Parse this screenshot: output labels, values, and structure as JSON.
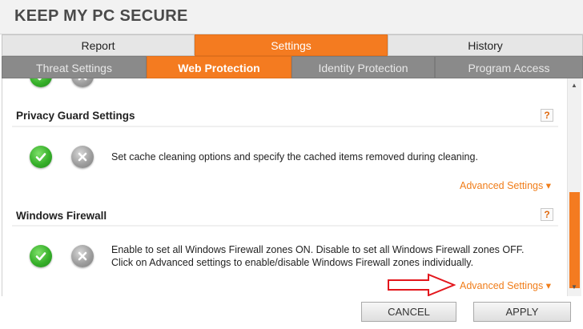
{
  "app": {
    "title": "KEEP MY PC SECURE"
  },
  "tabs_primary": [
    {
      "label": "Report",
      "active": false
    },
    {
      "label": "Settings",
      "active": true
    },
    {
      "label": "History",
      "active": false
    }
  ],
  "tabs_secondary": [
    {
      "label": "Threat Settings",
      "active": false
    },
    {
      "label": "Web Protection",
      "active": true
    },
    {
      "label": "Identity Protection",
      "active": false
    },
    {
      "label": "Program Access",
      "active": false
    }
  ],
  "sections": [
    {
      "title": "Privacy Guard Settings",
      "help": "?",
      "description": "Set cache cleaning options and specify the cached items removed during cleaning.",
      "advanced_link": "Advanced Settings ▾"
    },
    {
      "title": "Windows Firewall",
      "help": "?",
      "description_lines": [
        "Enable to set all Windows Firewall zones ON. Disable to set all Windows Firewall zones OFF.",
        "Click on Advanced settings to enable/disable Windows Firewall zones individually."
      ],
      "advanced_link": "Advanced Settings ▾"
    }
  ],
  "footer": {
    "cancel_label": "CANCEL",
    "apply_label": "APPLY"
  },
  "colors": {
    "accent": "#f47b20",
    "link": "#f07d1a",
    "tab_gray": "#8a8a8a",
    "annotation_arrow": "#e3161c"
  },
  "icons": {
    "on_toggle": "check-circle-icon",
    "off_toggle": "x-circle-icon",
    "help": "help-icon",
    "scroll_up": "scroll-up-icon",
    "scroll_down": "scroll-down-icon"
  }
}
